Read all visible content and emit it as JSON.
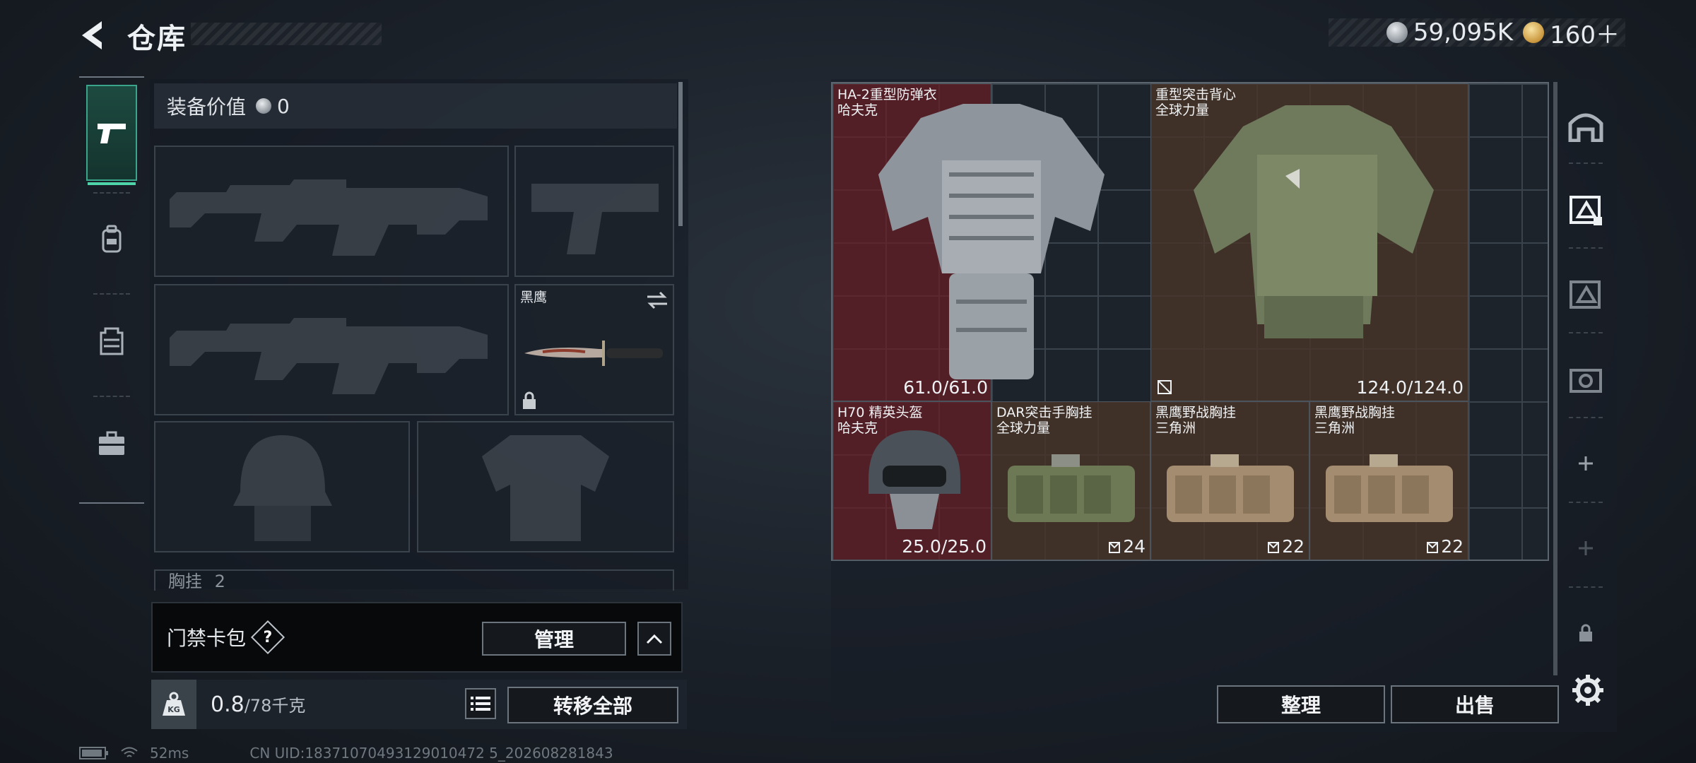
{
  "header": {
    "title": "仓库",
    "currencies": [
      {
        "icon": "silver-coin-icon",
        "amount": "59,095K"
      },
      {
        "icon": "gold-coin-icon",
        "amount": "160＋"
      }
    ]
  },
  "left_tabs": [
    {
      "icon": "pistol-icon",
      "active": true
    },
    {
      "icon": "backpack-icon",
      "active": false
    },
    {
      "icon": "vest-icon",
      "active": false
    },
    {
      "icon": "briefcase-icon",
      "active": false
    }
  ],
  "loadout": {
    "gear_value_label": "装备价值",
    "gear_value": "0",
    "melee_name": "黑鹰",
    "chest_header": "胸挂",
    "chest_count": "2"
  },
  "keycard": {
    "label": "门禁卡包",
    "help": "?",
    "manage_label": "管理"
  },
  "weight": {
    "kg_label": "KG",
    "current": "0.8",
    "max": "/78千克",
    "transfer_label": "转移全部"
  },
  "status": {
    "ping": "52ms",
    "uid": "CN UID:18371070493129010472 5_202608281843"
  },
  "storage_items": [
    {
      "name": "HA-2重型防弹衣",
      "brand": "哈夫克",
      "value": "61.0/61.0",
      "rarity": "red",
      "kind": "armor"
    },
    {
      "name": "重型突击背心",
      "brand": "全球力量",
      "value": "124.0/124.0",
      "rarity": "brown",
      "kind": "armor-green"
    },
    {
      "name": "H70 精英头盔",
      "brand": "哈夫克",
      "value": "25.0/25.0",
      "rarity": "red",
      "kind": "helmet"
    },
    {
      "name": "DAR突击手胸挂",
      "brand": "全球力量",
      "value": "24",
      "rarity": "brown",
      "kind": "rig-green"
    },
    {
      "name": "黑鹰野战胸挂",
      "brand": "三角洲",
      "value": "22",
      "rarity": "brown",
      "kind": "rig-tan"
    },
    {
      "name": "黑鹰野战胸挂",
      "brand": "三角洲",
      "value": "22",
      "rarity": "brown",
      "kind": "rig-tan"
    }
  ],
  "buttons": {
    "sort_label": "整理",
    "sell_label": "出售"
  },
  "colors": {
    "accent": "#3aa58a",
    "rarity_red": "#681e26",
    "rarity_brown": "#483428"
  }
}
